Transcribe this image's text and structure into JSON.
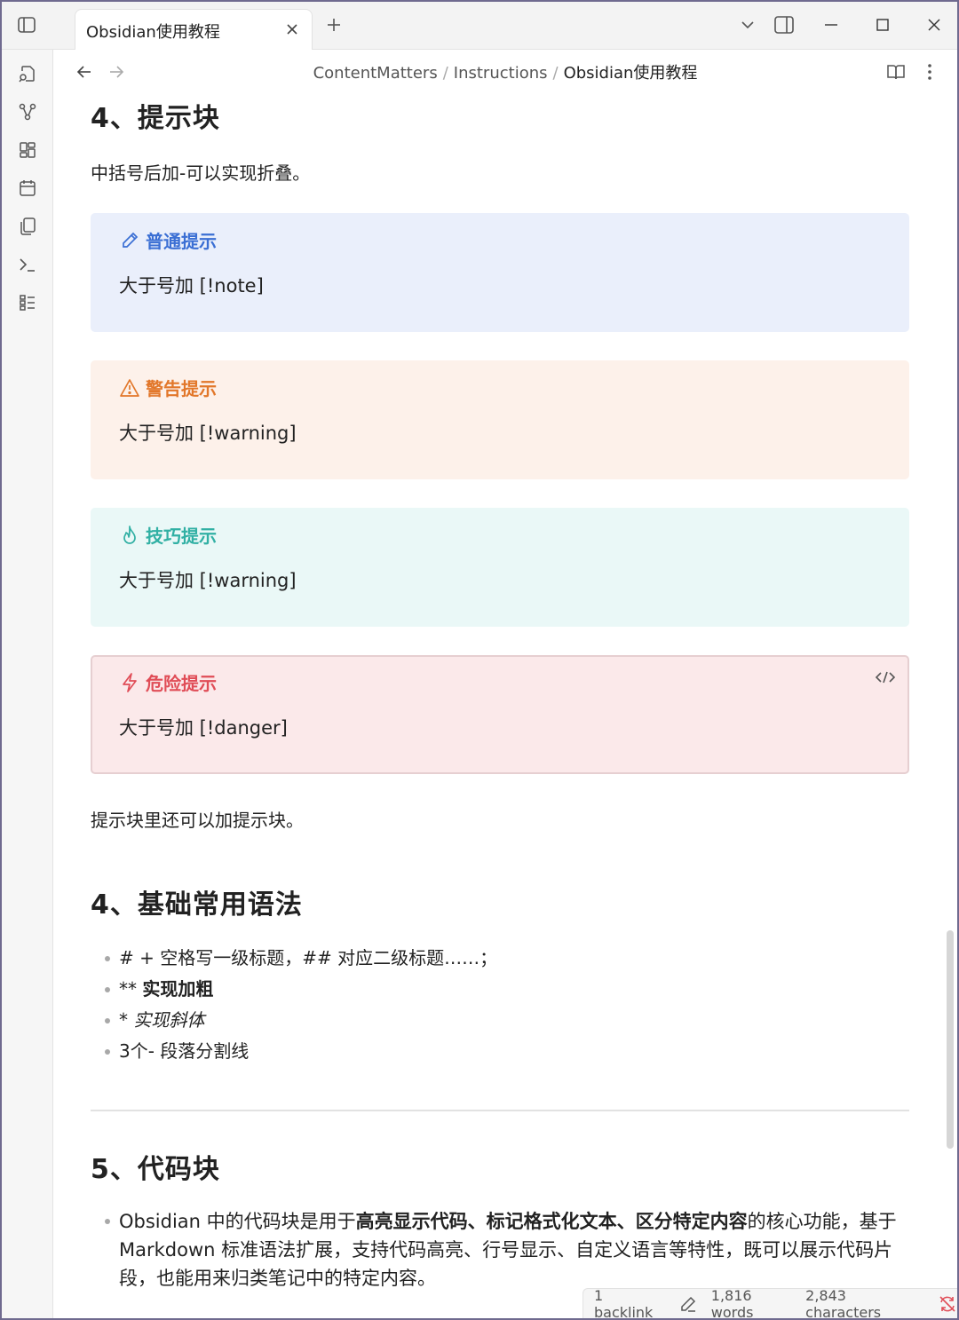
{
  "titlebar": {
    "tab_title": "Obsidian使用教程",
    "icons": [
      "sidebar-toggle-icon",
      "close-icon",
      "plus-icon",
      "chevron-down-icon",
      "right-sidebar-icon",
      "minimize-icon",
      "maximize-icon",
      "window-close-icon"
    ]
  },
  "ribbon": {
    "icons": [
      "open-quick-switcher-icon",
      "graph-view-icon",
      "canvas-icon",
      "daily-note-icon",
      "templates-icon",
      "command-palette-icon",
      "outline-icon"
    ]
  },
  "nav": {
    "breadcrumb": [
      "ContentMatters",
      "Instructions",
      "Obsidian使用教程"
    ],
    "separator": "/",
    "icons": [
      "back-arrow-icon",
      "forward-arrow-icon",
      "reading-view-icon",
      "more-options-icon"
    ]
  },
  "doc": {
    "h_callouts": "4、提示块",
    "p_fold": "中括号后加-可以实现折叠。",
    "callouts": [
      {
        "type": "note",
        "title": "普通提示",
        "body": "大于号加 [!note]",
        "icon": "pencil-icon",
        "color": "#3b6fd4"
      },
      {
        "type": "warning",
        "title": "警告提示",
        "body": "大于号加 [!warning]",
        "icon": "alert-triangle-icon",
        "color": "#e2772a"
      },
      {
        "type": "tip",
        "title": "技巧提示",
        "body": "大于号加 [!warning]",
        "icon": "flame-icon",
        "color": "#31b0a4"
      },
      {
        "type": "danger",
        "title": "危险提示",
        "body": "大于号加 [!danger]",
        "icon": "zap-icon",
        "color": "#e04d57"
      }
    ],
    "p_nested": "提示块里还可以加提示块。",
    "h_syntax": "4、基础常用语法",
    "syntax_items": {
      "item1": "# + 空格写一级标题，## 对应二级标题……；",
      "item2_prefix": "** ",
      "item2_bold": "实现加粗",
      "item3_prefix": "* ",
      "item3_italic": "实现斜体",
      "item4": "3个- 段落分割线"
    },
    "h_code": "5、代码块",
    "code_para": {
      "part1": "Obsidian 中的代码块是用于",
      "bold": "高亮显示代码、标记格式化文本、区分特定内容",
      "part2": "的核心功能，基于 Markdown 标准语法扩展，支持代码高亮、行号显示、自定义语言等特性，既可以展示代码片段，也能用来归类笔记中的特定内容。"
    }
  },
  "status": {
    "backlinks": "1 backlink",
    "words": "1,816 words",
    "chars": "2,843 characters",
    "icons": [
      "edit-icon",
      "sync-error-icon"
    ]
  }
}
